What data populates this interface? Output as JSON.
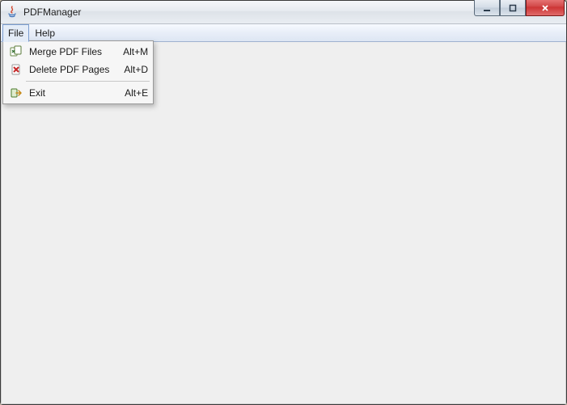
{
  "window": {
    "title": "PDFManager"
  },
  "menubar": {
    "file": "File",
    "help": "Help"
  },
  "file_menu": {
    "merge": {
      "label": "Merge PDF Files",
      "shortcut": "Alt+M"
    },
    "delete": {
      "label": "Delete PDF Pages",
      "shortcut": "Alt+D"
    },
    "exit": {
      "label": "Exit",
      "shortcut": "Alt+E"
    }
  }
}
